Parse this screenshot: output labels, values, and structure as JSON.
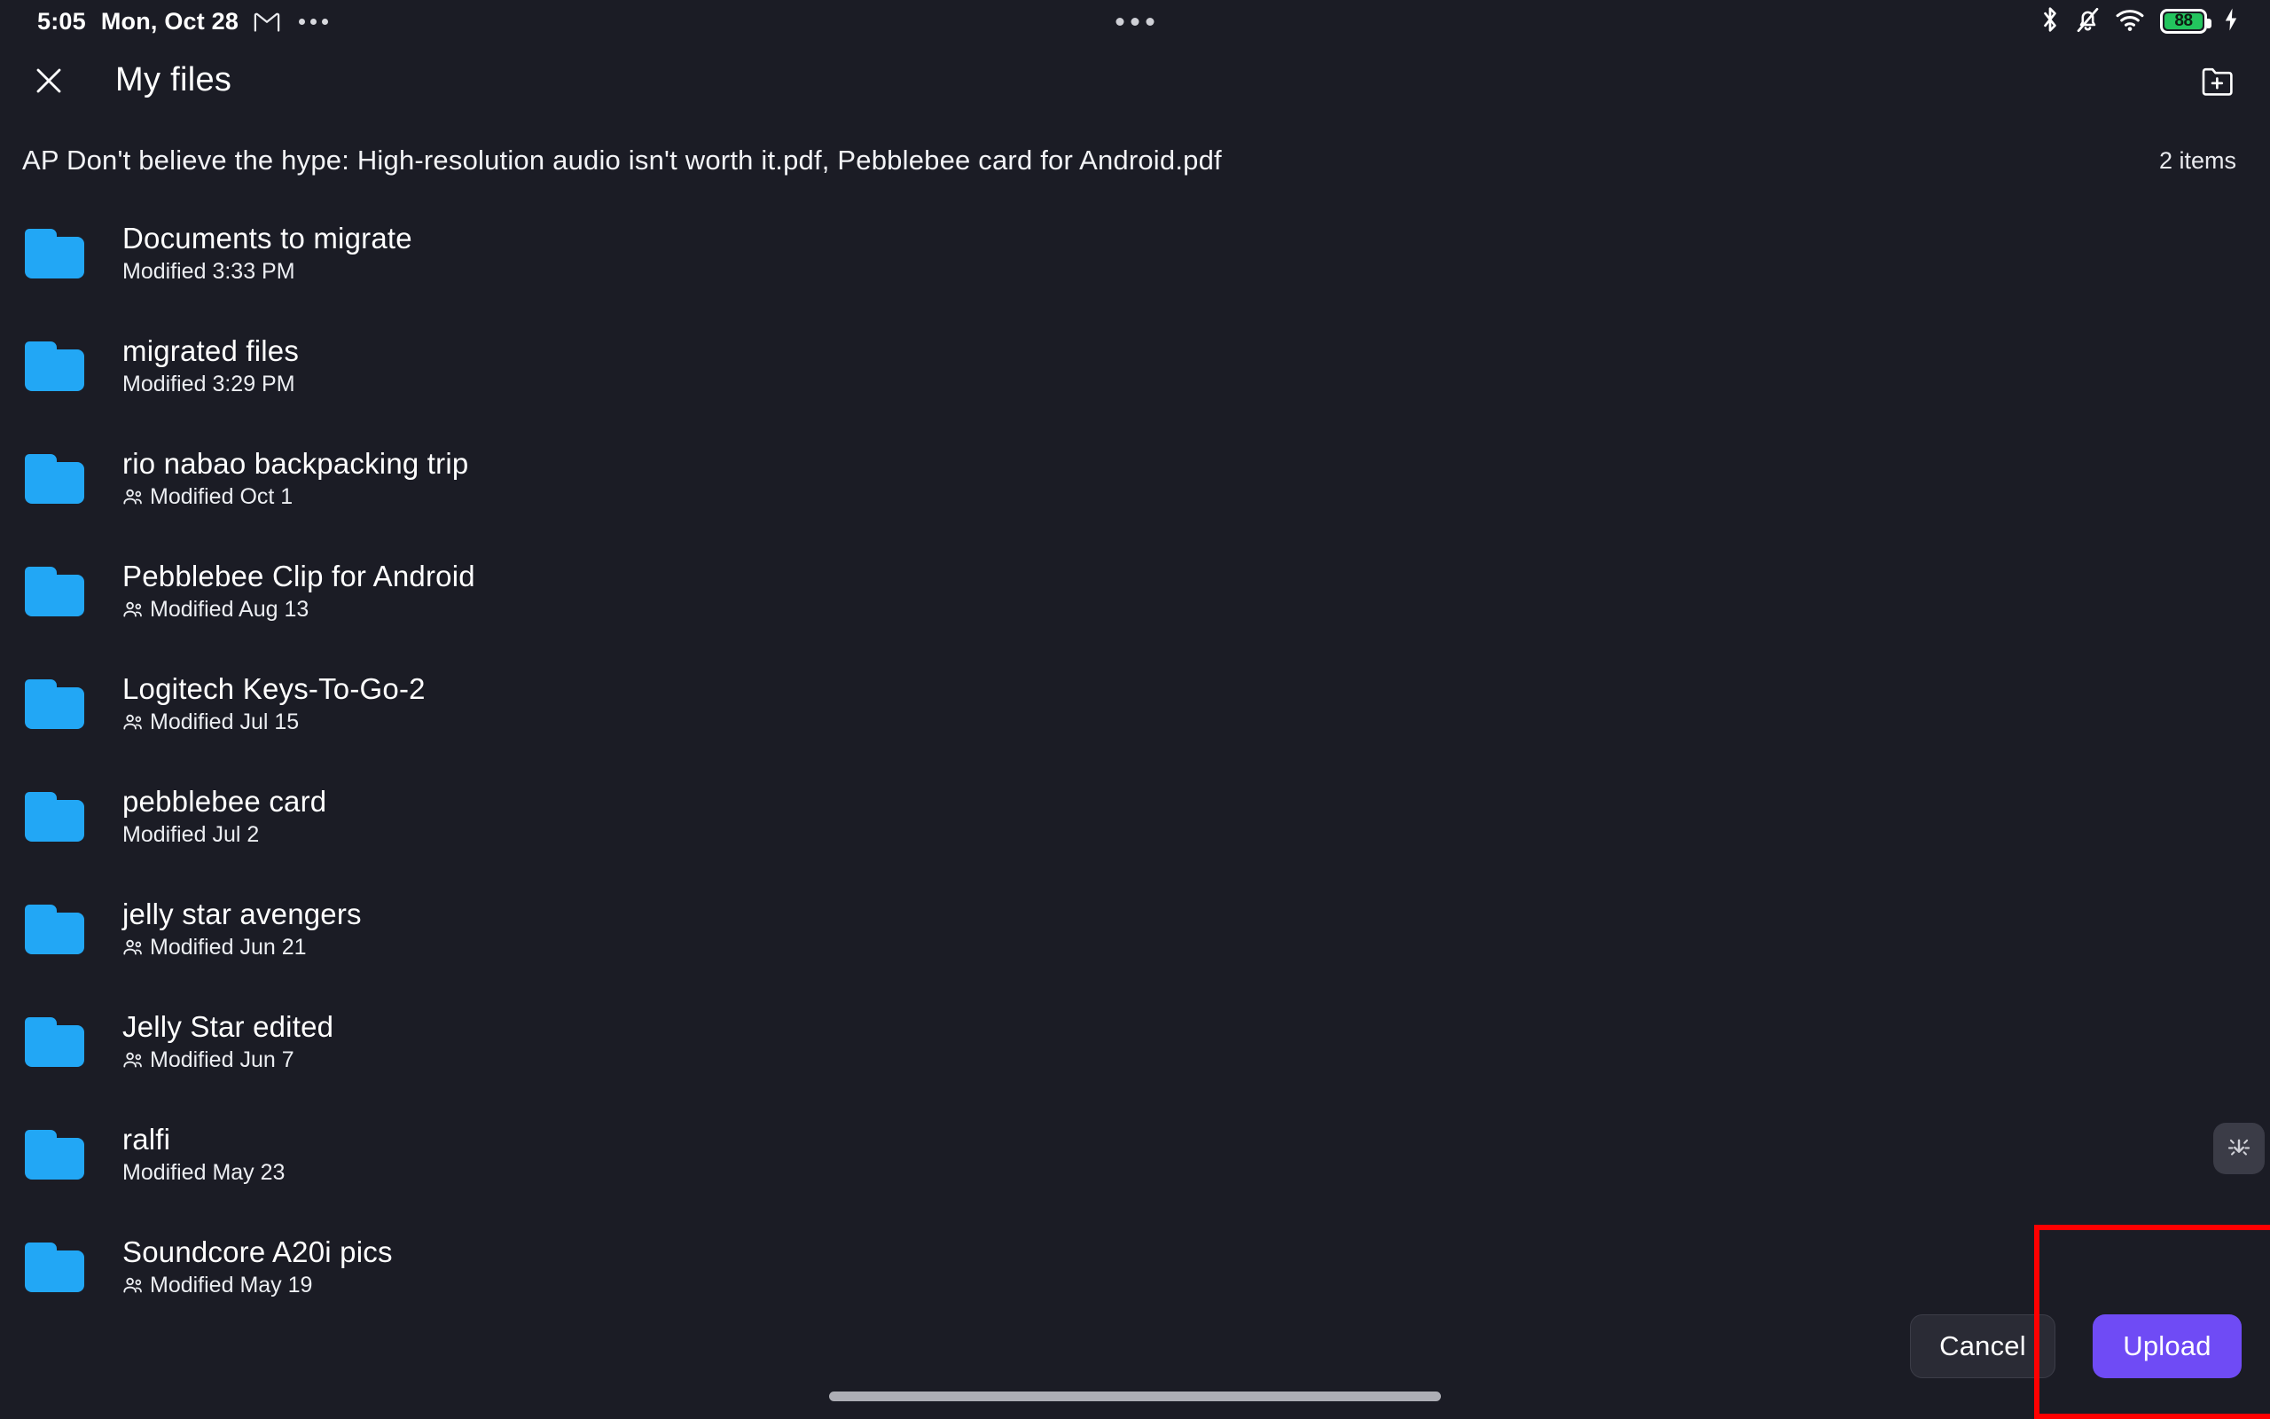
{
  "status_bar": {
    "time": "5:05",
    "date": "Mon, Oct 28",
    "gmail_icon": "gmail-icon",
    "overflow_icon": "more-dots-icon",
    "center_dots_icon": "camera-cutout-dots-icon",
    "bluetooth_icon": "bluetooth-icon",
    "mute_icon": "bell-muted-icon",
    "wifi_icon": "wifi-icon",
    "battery_percent": "88",
    "charging_icon": "charging-bolt-icon",
    "battery_fill_color": "#23c45e"
  },
  "header": {
    "close_icon": "close-icon",
    "title": "My files",
    "new_folder_icon": "new-folder-icon"
  },
  "subheader": {
    "selected_files": "AP Don't believe the hype: High-resolution audio isn't worth it.pdf, Pebblebee card for Android.pdf",
    "item_count": "2 items"
  },
  "folder_color": "#22a7f5",
  "files": [
    {
      "name": "Documents to migrate",
      "modified": "Modified 3:33 PM",
      "shared": false,
      "icon": "folder-icon"
    },
    {
      "name": "migrated files",
      "modified": "Modified 3:29 PM",
      "shared": false,
      "icon": "folder-icon"
    },
    {
      "name": "rio nabao backpacking trip",
      "modified": "Modified Oct 1",
      "shared": true,
      "icon": "folder-icon"
    },
    {
      "name": "Pebblebee Clip for Android",
      "modified": "Modified Aug 13",
      "shared": true,
      "icon": "folder-icon"
    },
    {
      "name": "Logitech Keys-To-Go-2",
      "modified": "Modified Jul 15",
      "shared": true,
      "icon": "folder-icon"
    },
    {
      "name": "pebblebee card",
      "modified": "Modified Jul 2",
      "shared": false,
      "icon": "folder-icon"
    },
    {
      "name": "jelly star avengers",
      "modified": "Modified Jun 21",
      "shared": true,
      "icon": "folder-icon"
    },
    {
      "name": "Jelly Star edited",
      "modified": "Modified Jun 7",
      "shared": true,
      "icon": "folder-icon"
    },
    {
      "name": "ralfi",
      "modified": "Modified May 23",
      "shared": false,
      "icon": "folder-icon"
    },
    {
      "name": "Soundcore A20i pics",
      "modified": "Modified May 19",
      "shared": true,
      "icon": "folder-icon"
    }
  ],
  "side_fab": {
    "icon": "collapse-arrow-icon"
  },
  "actions": {
    "cancel_label": "Cancel",
    "upload_label": "Upload",
    "upload_color": "#6f4bf5"
  },
  "annotation": {
    "color": "#ff0000"
  },
  "gesture_bar": {
    "icon": "home-indicator"
  }
}
